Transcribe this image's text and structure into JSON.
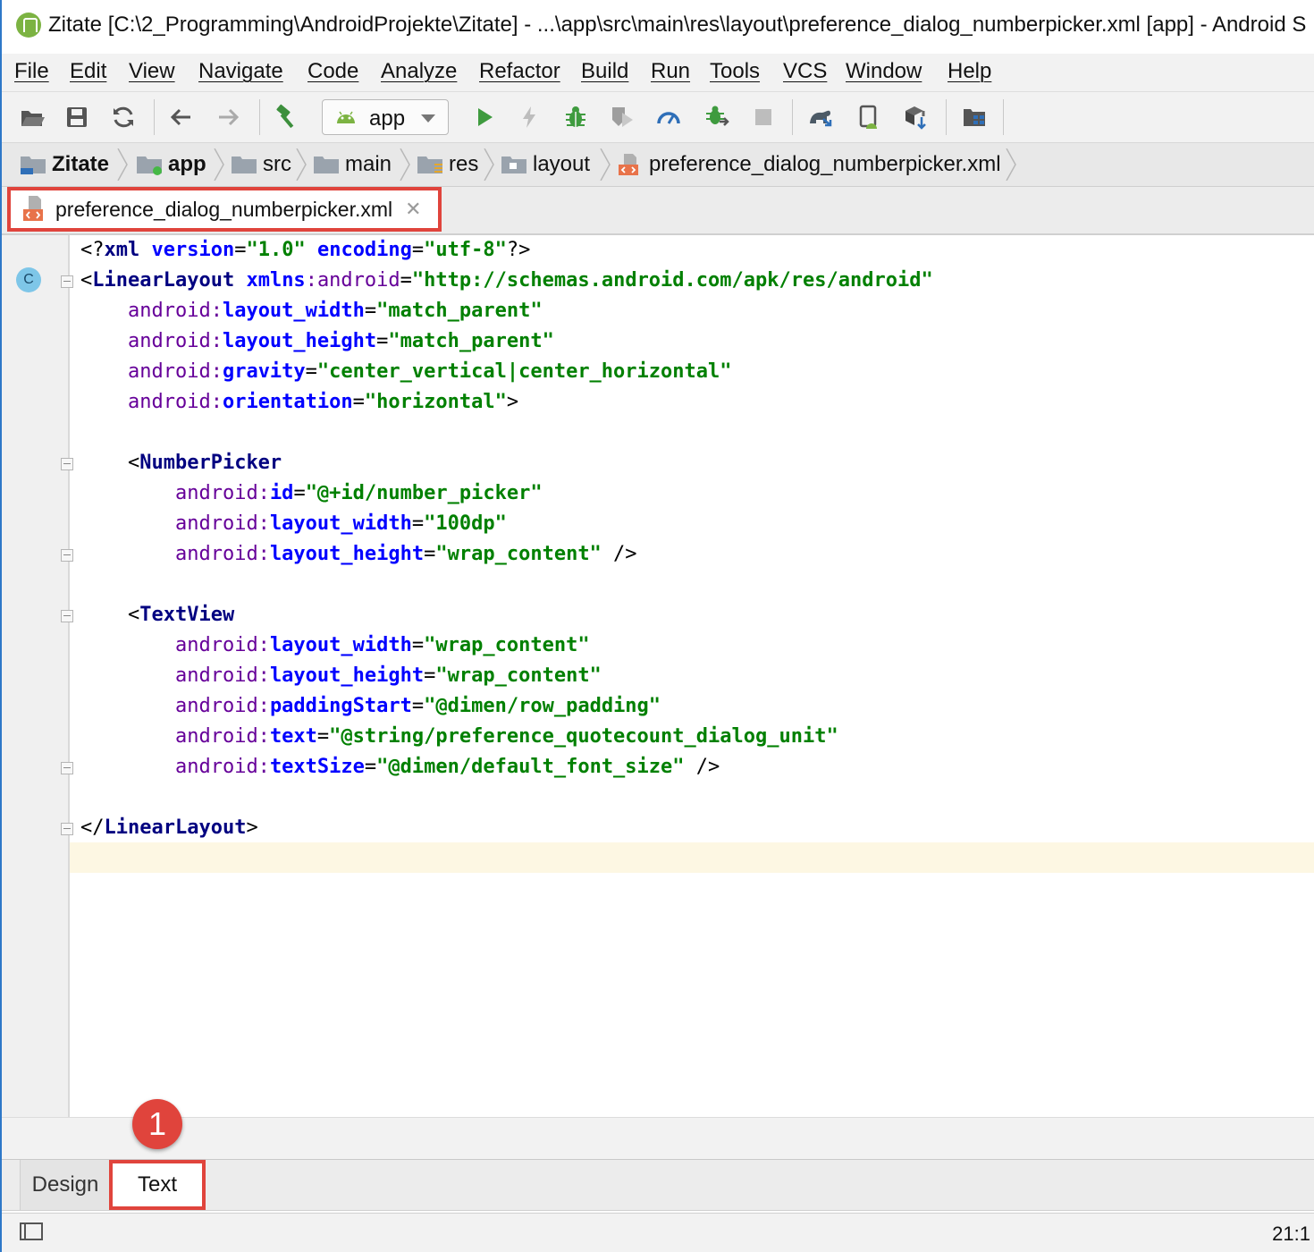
{
  "window": {
    "title": "Zitate [C:\\2_Programming\\AndroidProjekte\\Zitate] - ...\\app\\src\\main\\res\\layout\\preference_dialog_numberpicker.xml [app] - Android S"
  },
  "menu": {
    "items": [
      "File",
      "Edit",
      "View",
      "Navigate",
      "Code",
      "Analyze",
      "Refactor",
      "Build",
      "Run",
      "Tools",
      "VCS",
      "Window",
      "Help"
    ]
  },
  "toolbar": {
    "run_config": "app",
    "icons": [
      "open-folder-icon",
      "save-icon",
      "sync-icon",
      "back-arrow-icon",
      "forward-arrow-icon",
      "build-hammer-icon",
      "run-icon",
      "apply-changes-icon",
      "debug-icon",
      "coverage-icon",
      "profile-icon",
      "attach-debugger-icon",
      "stop-icon",
      "gradle-sync-icon",
      "avd-manager-icon",
      "sdk-manager-icon",
      "project-structure-icon"
    ]
  },
  "breadcrumb": {
    "items": [
      "Zitate",
      "app",
      "src",
      "main",
      "res",
      "layout",
      "preference_dialog_numberpicker.xml"
    ]
  },
  "editor": {
    "tab_name": "preference_dialog_numberpicker.xml",
    "gutter_marker": "C",
    "lines": [
      {
        "parts": [
          [
            "pi",
            "<?"
          ],
          [
            "tag",
            "xml"
          ],
          [
            "pi",
            " "
          ],
          [
            "attr",
            "version"
          ],
          [
            "pi",
            "="
          ],
          [
            "val",
            "\"1.0\""
          ],
          [
            "pi",
            " "
          ],
          [
            "attr",
            "encoding"
          ],
          [
            "pi",
            "="
          ],
          [
            "val",
            "\"utf-8\""
          ],
          [
            "pi",
            "?>"
          ]
        ]
      },
      {
        "parts": [
          [
            "pi",
            "<"
          ],
          [
            "tag",
            "LinearLayout"
          ],
          [
            "pi",
            " "
          ],
          [
            "attr",
            "xmlns"
          ],
          [
            "ns",
            ":"
          ],
          [
            "ns",
            "android"
          ],
          [
            "pi",
            "="
          ],
          [
            "val",
            "\"http://schemas.android.com/apk/res/android\""
          ]
        ]
      },
      {
        "parts": [
          [
            "pi",
            "    "
          ],
          [
            "ns",
            "android:"
          ],
          [
            "attr",
            "layout_width"
          ],
          [
            "pi",
            "="
          ],
          [
            "val",
            "\"match_parent\""
          ]
        ]
      },
      {
        "parts": [
          [
            "pi",
            "    "
          ],
          [
            "ns",
            "android:"
          ],
          [
            "attr",
            "layout_height"
          ],
          [
            "pi",
            "="
          ],
          [
            "val",
            "\"match_parent\""
          ]
        ]
      },
      {
        "parts": [
          [
            "pi",
            "    "
          ],
          [
            "ns",
            "android:"
          ],
          [
            "attr",
            "gravity"
          ],
          [
            "pi",
            "="
          ],
          [
            "val",
            "\"center_vertical|center_horizontal\""
          ]
        ]
      },
      {
        "parts": [
          [
            "pi",
            "    "
          ],
          [
            "ns",
            "android:"
          ],
          [
            "attr",
            "orientation"
          ],
          [
            "pi",
            "="
          ],
          [
            "val",
            "\"horizontal\""
          ],
          [
            "pi",
            ">"
          ]
        ]
      },
      {
        "parts": []
      },
      {
        "parts": [
          [
            "pi",
            "    <"
          ],
          [
            "tag",
            "NumberPicker"
          ]
        ]
      },
      {
        "parts": [
          [
            "pi",
            "        "
          ],
          [
            "ns",
            "android:"
          ],
          [
            "attr",
            "id"
          ],
          [
            "pi",
            "="
          ],
          [
            "val",
            "\"@+id/number_picker\""
          ]
        ]
      },
      {
        "parts": [
          [
            "pi",
            "        "
          ],
          [
            "ns",
            "android:"
          ],
          [
            "attr",
            "layout_width"
          ],
          [
            "pi",
            "="
          ],
          [
            "val",
            "\"100dp\""
          ]
        ]
      },
      {
        "parts": [
          [
            "pi",
            "        "
          ],
          [
            "ns",
            "android:"
          ],
          [
            "attr",
            "layout_height"
          ],
          [
            "pi",
            "="
          ],
          [
            "val",
            "\"wrap_content\""
          ],
          [
            "pi",
            " />"
          ]
        ]
      },
      {
        "parts": []
      },
      {
        "parts": [
          [
            "pi",
            "    <"
          ],
          [
            "tag",
            "TextView"
          ]
        ]
      },
      {
        "parts": [
          [
            "pi",
            "        "
          ],
          [
            "ns",
            "android:"
          ],
          [
            "attr",
            "layout_width"
          ],
          [
            "pi",
            "="
          ],
          [
            "val",
            "\"wrap_content\""
          ]
        ]
      },
      {
        "parts": [
          [
            "pi",
            "        "
          ],
          [
            "ns",
            "android:"
          ],
          [
            "attr",
            "layout_height"
          ],
          [
            "pi",
            "="
          ],
          [
            "val",
            "\"wrap_content\""
          ]
        ]
      },
      {
        "parts": [
          [
            "pi",
            "        "
          ],
          [
            "ns",
            "android:"
          ],
          [
            "attr",
            "paddingStart"
          ],
          [
            "pi",
            "="
          ],
          [
            "val",
            "\"@dimen/row_padding\""
          ]
        ]
      },
      {
        "parts": [
          [
            "pi",
            "        "
          ],
          [
            "ns",
            "android:"
          ],
          [
            "attr",
            "text"
          ],
          [
            "pi",
            "="
          ],
          [
            "val",
            "\"@string/preference_quotecount_dialog_unit\""
          ]
        ]
      },
      {
        "parts": [
          [
            "pi",
            "        "
          ],
          [
            "ns",
            "android:"
          ],
          [
            "attr",
            "textSize"
          ],
          [
            "pi",
            "="
          ],
          [
            "val",
            "\"@dimen/default_font_size\""
          ],
          [
            "pi",
            " />"
          ]
        ]
      },
      {
        "parts": []
      },
      {
        "parts": [
          [
            "pi",
            "</"
          ],
          [
            "tag",
            "LinearLayout"
          ],
          [
            "pi",
            ">"
          ]
        ]
      }
    ]
  },
  "bottom_tabs": {
    "design": "Design",
    "text": "Text"
  },
  "annotation": {
    "callout_number": "1"
  },
  "status": {
    "position": "21:1"
  },
  "colors": {
    "highlight_red": "#e0443c",
    "android_green": "#7cb342"
  }
}
